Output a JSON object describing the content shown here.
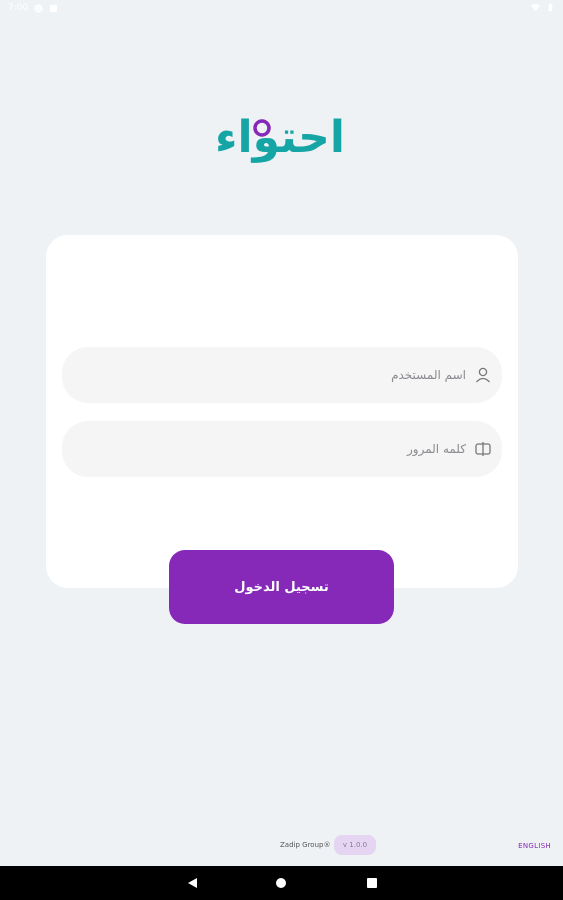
{
  "status_bar": {
    "time": "7:00",
    "icons": [
      "g-icon",
      "notification-icon",
      "wifi-icon",
      "battery-icon"
    ]
  },
  "logo": {
    "text": "احتواء",
    "colors": {
      "teal": "#16a5a5",
      "purple": "#8628b8"
    }
  },
  "login_form": {
    "username_placeholder": "اسم المستخدم",
    "password_placeholder": "كلمه المرور",
    "login_button_label": "تسجيل الدخول"
  },
  "footer": {
    "company": "Zadip Group®",
    "version": "v 1.0.0",
    "language_switch": "ENGLISH"
  },
  "colors": {
    "background": "#eef2f5",
    "card": "#ffffff",
    "field": "#f5f5f6",
    "primary": "#8628b8"
  }
}
